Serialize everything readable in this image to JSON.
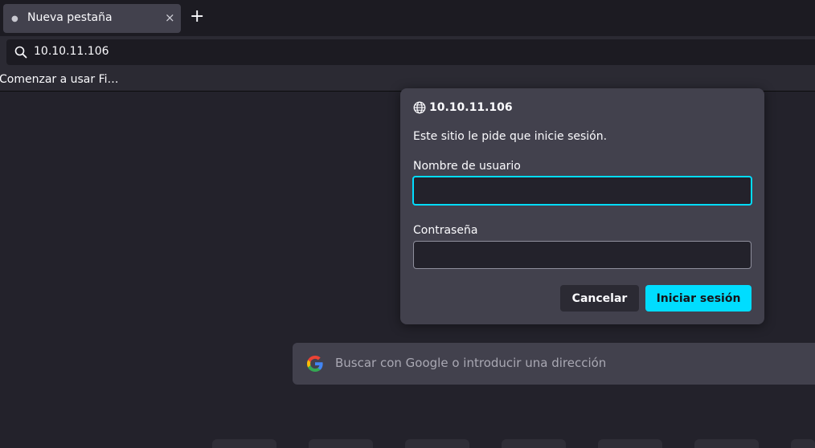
{
  "tabs": [
    {
      "title": "Nueva pestaña",
      "close_glyph": "×"
    }
  ],
  "new_tab_glyph": "+",
  "urlbar": {
    "value": "10.10.11.106",
    "icon": "search-icon"
  },
  "bookmarks": [
    {
      "label": "Comenzar a usar Fi…"
    }
  ],
  "search": {
    "placeholder": "Buscar con Google o introducir una dirección",
    "icon": "google-icon"
  },
  "dialog": {
    "host": "10.10.11.106",
    "message": "Este sitio le pide que inicie sesión.",
    "username_label": "Nombre de usuario",
    "username_value": "",
    "password_label": "Contraseña",
    "password_value": "",
    "cancel_label": "Cancelar",
    "login_label": "Iniciar sesión",
    "accent_color": "#00ddff"
  }
}
